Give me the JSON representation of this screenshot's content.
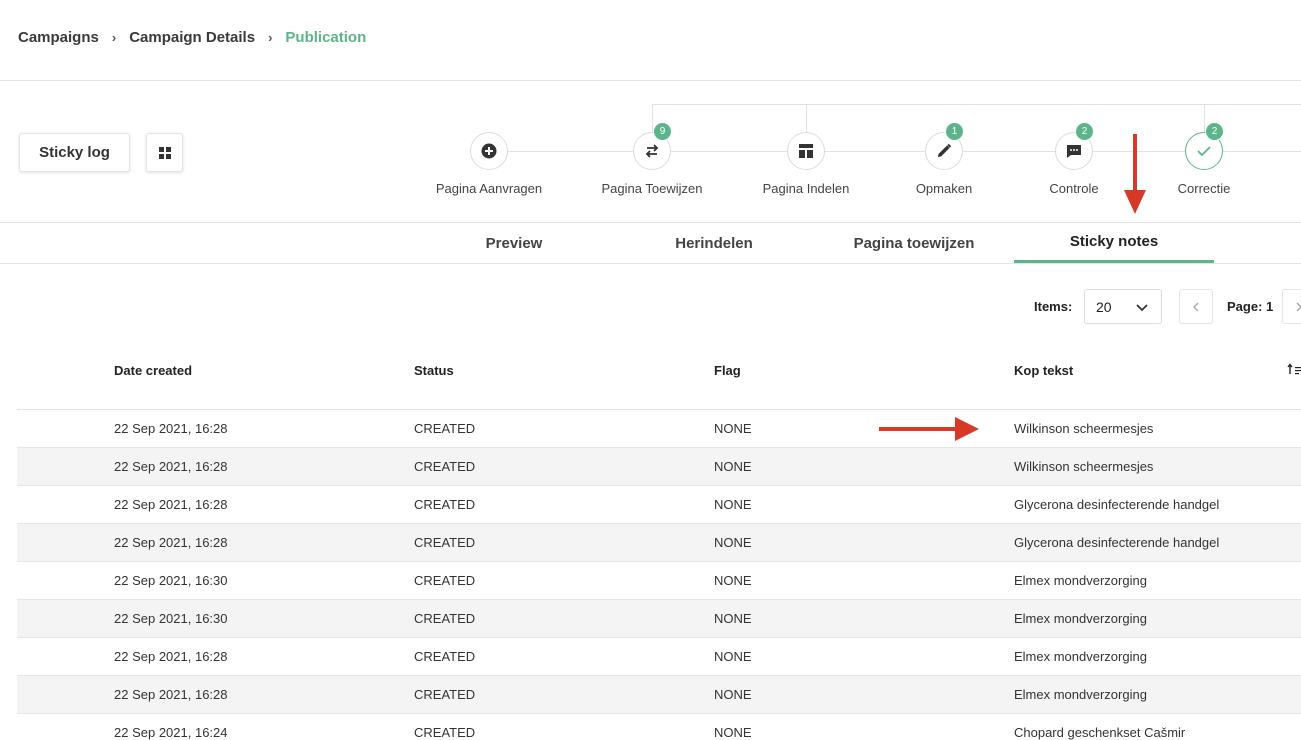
{
  "breadcrumb": {
    "items": [
      "Campaigns",
      "Campaign Details",
      "Publication"
    ],
    "separator": "›"
  },
  "toolbar": {
    "sticky_log_label": "Sticky log",
    "grid_icon": "grid-view-icon"
  },
  "workflow": {
    "steps": [
      {
        "label": "Pagina Aanvragen",
        "icon": "add-circle-icon",
        "badge": ""
      },
      {
        "label": "Pagina Toewijzen",
        "icon": "swap-arrows-icon",
        "badge": "9"
      },
      {
        "label": "Pagina Indelen",
        "icon": "layout-icon",
        "badge": ""
      },
      {
        "label": "Opmaken",
        "icon": "pencil-icon",
        "badge": "1"
      },
      {
        "label": "Controle",
        "icon": "chat-bubble-icon",
        "badge": "2"
      },
      {
        "label": "Correctie",
        "icon": "checkmark-icon",
        "badge": "2",
        "active": true
      }
    ]
  },
  "tabs": {
    "items": [
      "Preview",
      "Herindelen",
      "Pagina toewijzen",
      "Sticky notes"
    ],
    "active": "Sticky notes"
  },
  "pagination": {
    "items_label": "Items:",
    "items_value": "20",
    "page_label": "Page: 1",
    "prev_icon": "chevron-left-icon",
    "next_icon": "chevron-right-icon"
  },
  "table": {
    "columns": [
      "Date created",
      "Status",
      "Flag",
      "Kop tekst"
    ],
    "rows": [
      [
        "22 Sep 2021, 16:28",
        "CREATED",
        "NONE",
        "Wilkinson scheermesjes"
      ],
      [
        "22 Sep 2021, 16:28",
        "CREATED",
        "NONE",
        "Wilkinson scheermesjes"
      ],
      [
        "22 Sep 2021, 16:28",
        "CREATED",
        "NONE",
        "Glycerona desinfecterende handgel"
      ],
      [
        "22 Sep 2021, 16:28",
        "CREATED",
        "NONE",
        "Glycerona desinfecterende handgel"
      ],
      [
        "22 Sep 2021, 16:30",
        "CREATED",
        "NONE",
        "Elmex mondverzorging"
      ],
      [
        "22 Sep 2021, 16:30",
        "CREATED",
        "NONE",
        "Elmex mondverzorging"
      ],
      [
        "22 Sep 2021, 16:28",
        "CREATED",
        "NONE",
        "Elmex mondverzorging"
      ],
      [
        "22 Sep 2021, 16:28",
        "CREATED",
        "NONE",
        "Elmex mondverzorging"
      ],
      [
        "22 Sep 2021, 16:24",
        "CREATED",
        "NONE",
        "Chopard geschenkset Cašmir"
      ]
    ]
  },
  "colors": {
    "accent": "#5cb58a",
    "annotation": "#d63a26"
  }
}
